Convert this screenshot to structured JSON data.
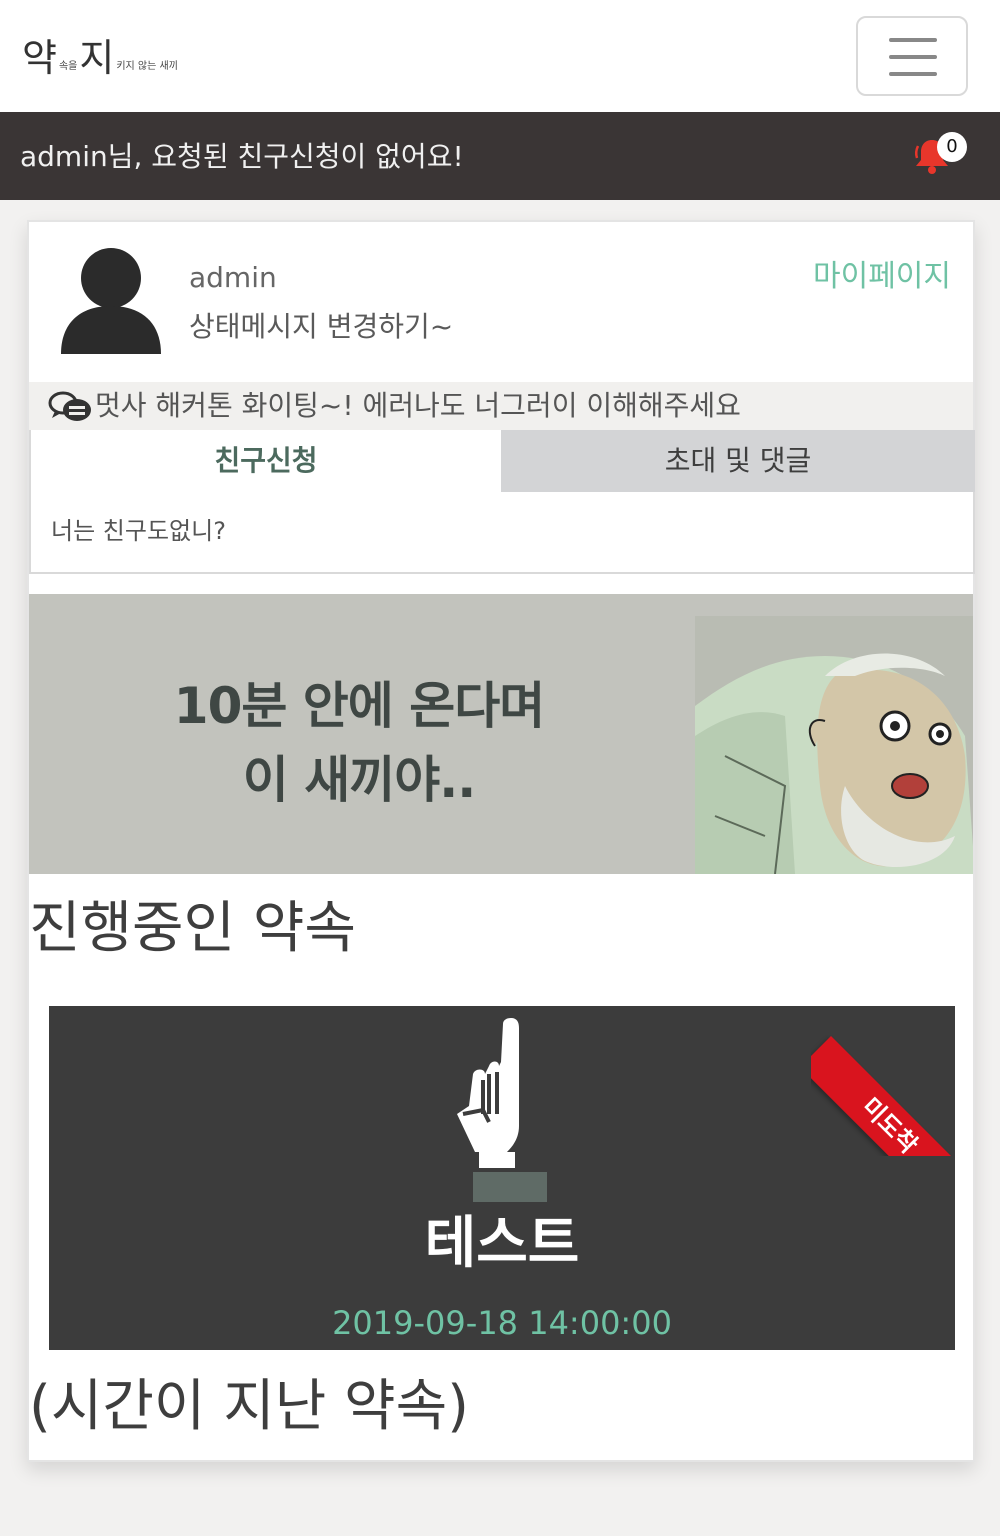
{
  "header": {
    "logo_main_1": "약",
    "logo_small_1": "속을",
    "logo_main_2": "지",
    "logo_small_2": "키지 않는 새끼",
    "menu_icon": "hamburger-icon"
  },
  "notice": {
    "text": "admin님, 요청된 친구신청이 없어요!",
    "bell_icon": "bell-icon",
    "bell_count": "0",
    "bell_color": "#e8362b"
  },
  "profile": {
    "avatar_icon": "user-silhouette-icon",
    "username": "admin",
    "status_message": "상태메시지 변경하기~",
    "mypage_label": "마이페이지"
  },
  "motto": {
    "icon": "chat-bubbles-icon",
    "text": "멋사 해커톤 화이팅~! 에러나도 너그러이 이해해주세요"
  },
  "tabs": {
    "items": [
      {
        "label": "친구신청",
        "active": true
      },
      {
        "label": "초대 및 댓글",
        "active": false
      }
    ],
    "content_text": "너는 친구도없니?"
  },
  "banner": {
    "line1": "10분 안에 온다며",
    "line2": "이 새끼야.."
  },
  "sections": {
    "ongoing_title": "진행중인 약속",
    "past_title": "(시간이 지난 약속)"
  },
  "promise": {
    "icon": "pointing-hand-icon",
    "title": "테스트",
    "datetime": "2019-09-18 14:00:00",
    "ribbon_label": "미도착",
    "ribbon_color": "#d9141e"
  },
  "colors": {
    "accent": "#6fc2a4",
    "notice_bg": "#3a3535",
    "card_bg": "#3c3c3c"
  }
}
